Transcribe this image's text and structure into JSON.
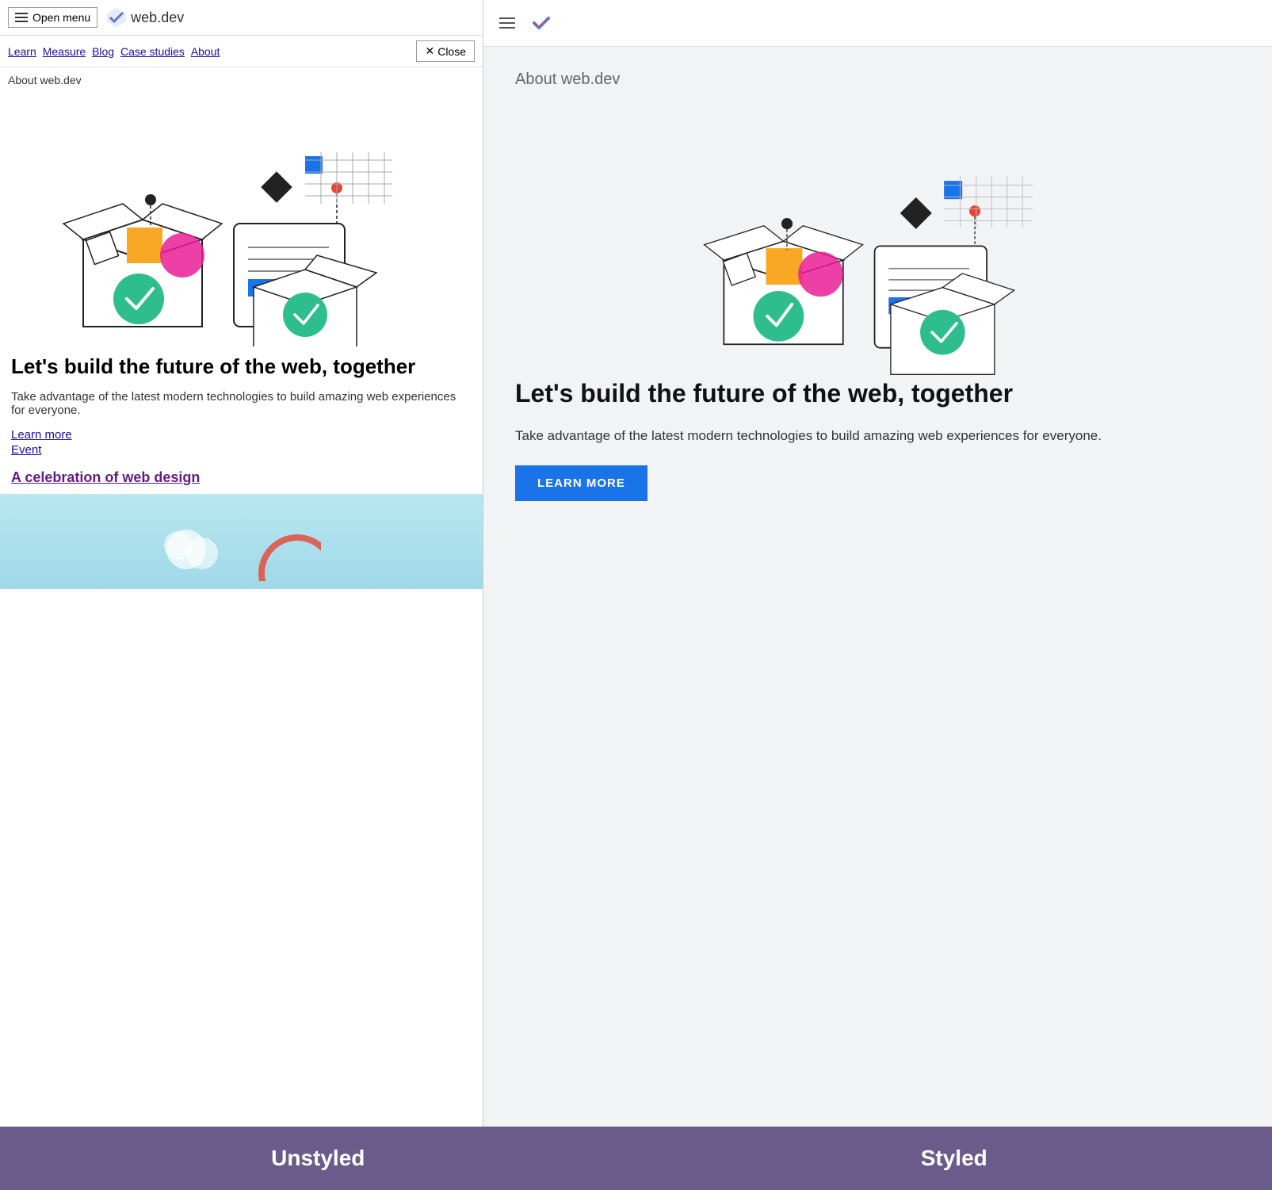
{
  "left": {
    "nav": {
      "open_menu_label": "Open menu",
      "site_name": "web.dev",
      "close_label": "Close",
      "nav_links": [
        "Learn",
        "Measure",
        "Blog",
        "Case studies",
        "About"
      ],
      "about_text": "About web.dev"
    },
    "hero": {
      "heading": "Let's build the future of the web, together",
      "description": "Take advantage of the latest modern technologies to build amazing web experiences for everyone.",
      "link1": "Learn more",
      "link2": "Event",
      "event_link": "A celebration of web design"
    }
  },
  "right": {
    "about_text": "About web.dev",
    "hero": {
      "heading": "Let's build the future of the web, together",
      "description": "Take advantage of the latest modern technologies to build amazing web experiences for everyone.",
      "button_label": "LEARN MORE"
    }
  },
  "labels": {
    "unstyled": "Unstyled",
    "styled": "Styled"
  }
}
